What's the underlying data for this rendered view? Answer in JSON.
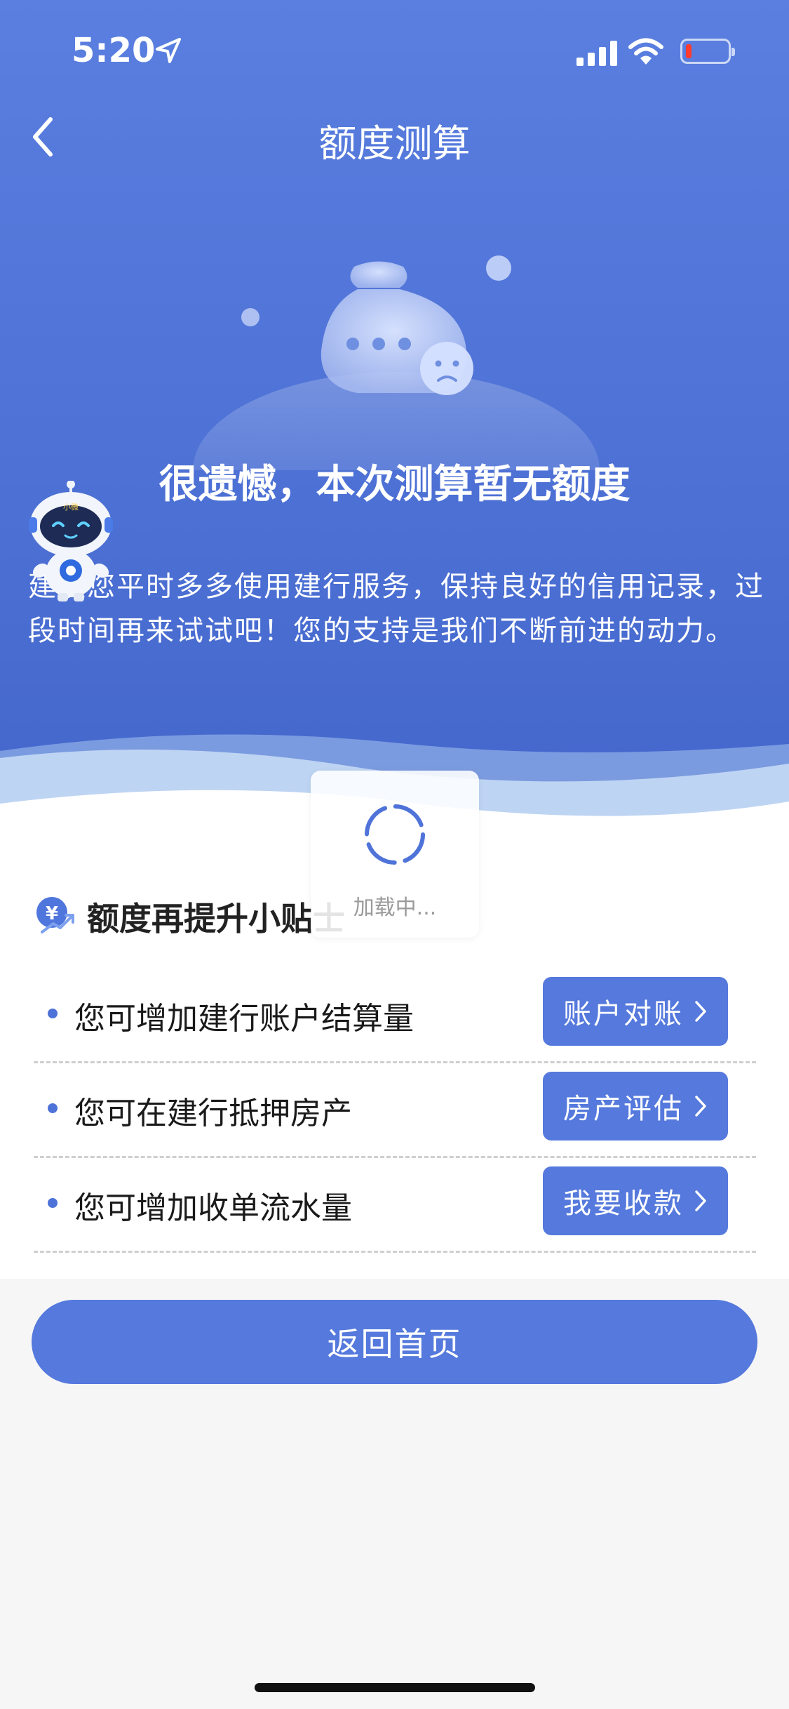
{
  "status_bar": {
    "time": "5:20"
  },
  "nav": {
    "title": "额度测算"
  },
  "result": {
    "title": "很遗憾，本次测算暂无额度",
    "description": "建议您平时多多使用建行服务，保持良好的信用记录，过段时间再来试试吧！您的支持是我们不断前进的动力。"
  },
  "robot": {
    "badge": "小微"
  },
  "tips": {
    "title": "额度再提升小贴士",
    "items": [
      {
        "text": "您可增加建行账户结算量",
        "button": "账户对账"
      },
      {
        "text": "您可在建行抵押房产",
        "button": "房产评估"
      },
      {
        "text": "您可增加收单流水量",
        "button": "我要收款"
      }
    ]
  },
  "loading": {
    "text": "加载中..."
  },
  "footer": {
    "home_button": "返回首页"
  },
  "colors": {
    "primary": "#5579dc",
    "hero_top": "#5a7fe0",
    "hero_bottom": "#4466cc",
    "background": "#f6f6f6"
  }
}
